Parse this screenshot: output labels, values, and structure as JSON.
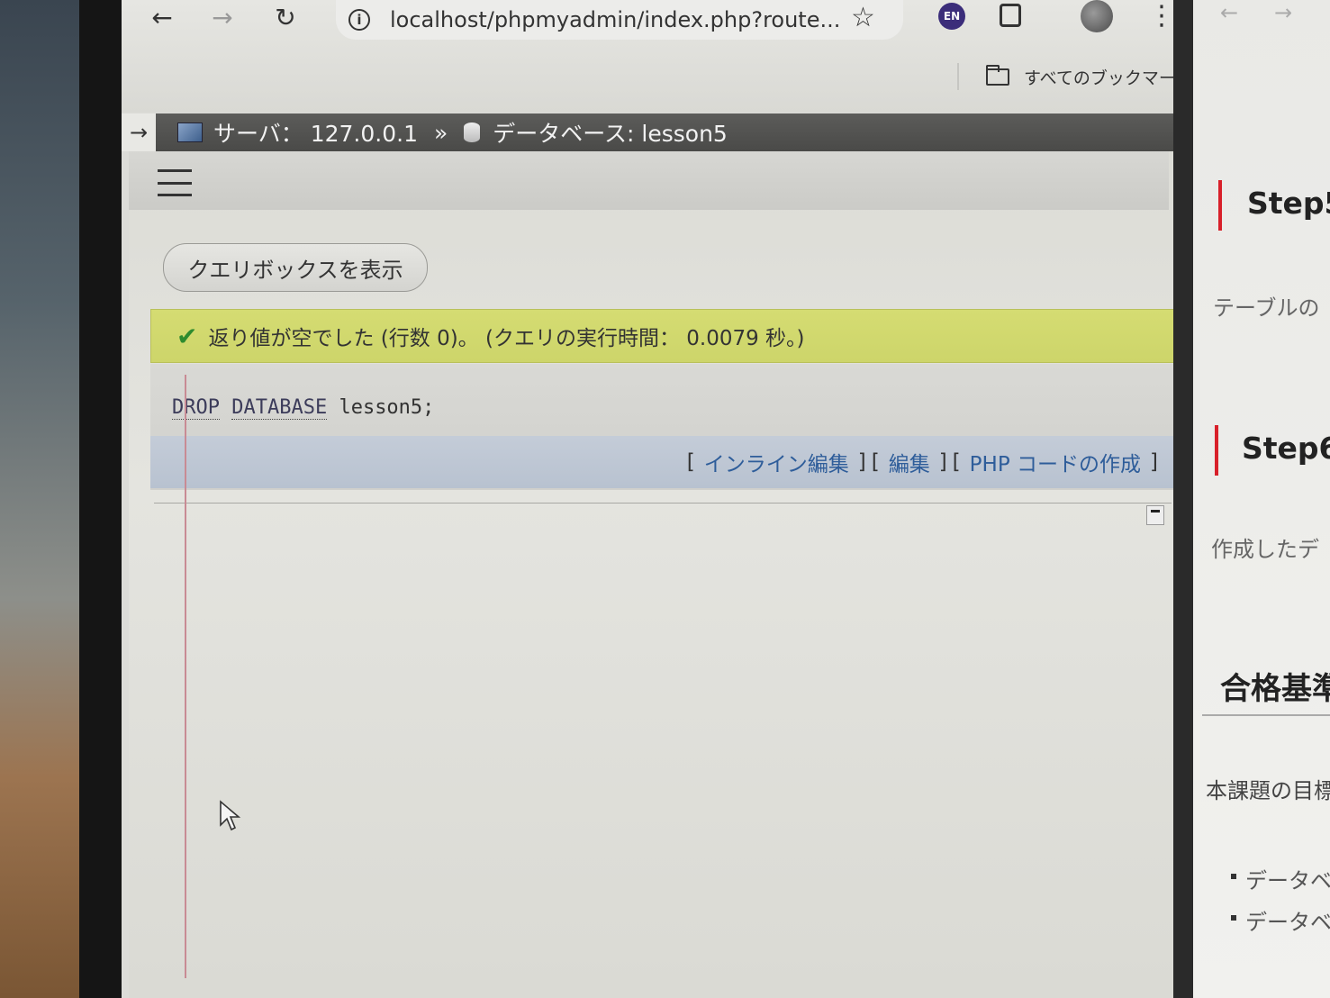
{
  "browser": {
    "url": "localhost/phpmyadmin/index.php?route...",
    "lang_badge": "EN",
    "bookmarks_label": "すべてのブックマーク",
    "icons": [
      "back-icon",
      "forward-icon",
      "reload-icon",
      "info-icon",
      "star-icon",
      "extensions-icon",
      "avatar-icon",
      "menu-icon",
      "folder-icon"
    ]
  },
  "breadcrumb": {
    "server": "サーバ： 127.0.0.1",
    "separator": "»",
    "database": "データベース: lesson5"
  },
  "main": {
    "query_box_button": "クエリボックスを表示",
    "success_message": "返り値が空でした (行数 0)。 (クエリの実行時間： 0.0079 秒。)",
    "sql": {
      "keyword1": "DROP",
      "keyword2": "DATABASE",
      "rest": " lesson5;"
    },
    "links": {
      "inline_edit": "インライン編集",
      "edit": "編集",
      "php_code": "PHP コードの作成"
    }
  },
  "right_pane": {
    "step5": "Step5",
    "step5_text": "テーブルの",
    "step6": "Step6",
    "step6_text": "作成したデ",
    "criteria_heading": "合格基準",
    "criteria_text": "本課題の目標",
    "bullets": [
      "データベ",
      "データベ"
    ]
  },
  "colors": {
    "success_bg": "#d5dc72",
    "link": "#2e5d9a",
    "breadcrumb_bg": "#4f4f4d",
    "accent_red": "#d8202a"
  }
}
